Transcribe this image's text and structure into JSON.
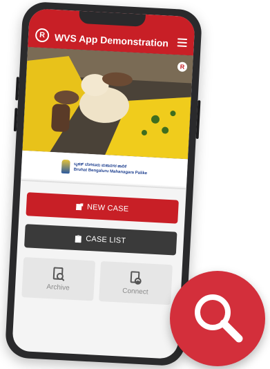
{
  "app": {
    "title": "WVS App Demonstration",
    "logo_text": "R"
  },
  "partner": {
    "line1": "ಬೃಹತ್ ಬೆಂಗಳೂರು ಮಹಾನಗರ ಪಾಲಿಕೆ",
    "line2": "Bruhat Bengaluru Mahanagara Palike"
  },
  "buttons": {
    "new_case": "NEW CASE",
    "case_list": "CASE LIST"
  },
  "tiles": {
    "archive": "Archive",
    "connect": "Connect"
  },
  "colors": {
    "brand_red": "#c81f26",
    "dark_button": "#3a3a3a",
    "badge_red": "#d32f3b"
  },
  "icons": {
    "menu": "hamburger-menu-icon",
    "new_case": "add-case-icon",
    "case_list": "clipboard-icon",
    "archive": "archive-search-icon",
    "connect": "connect-sync-icon",
    "badge": "magnifier-icon"
  }
}
